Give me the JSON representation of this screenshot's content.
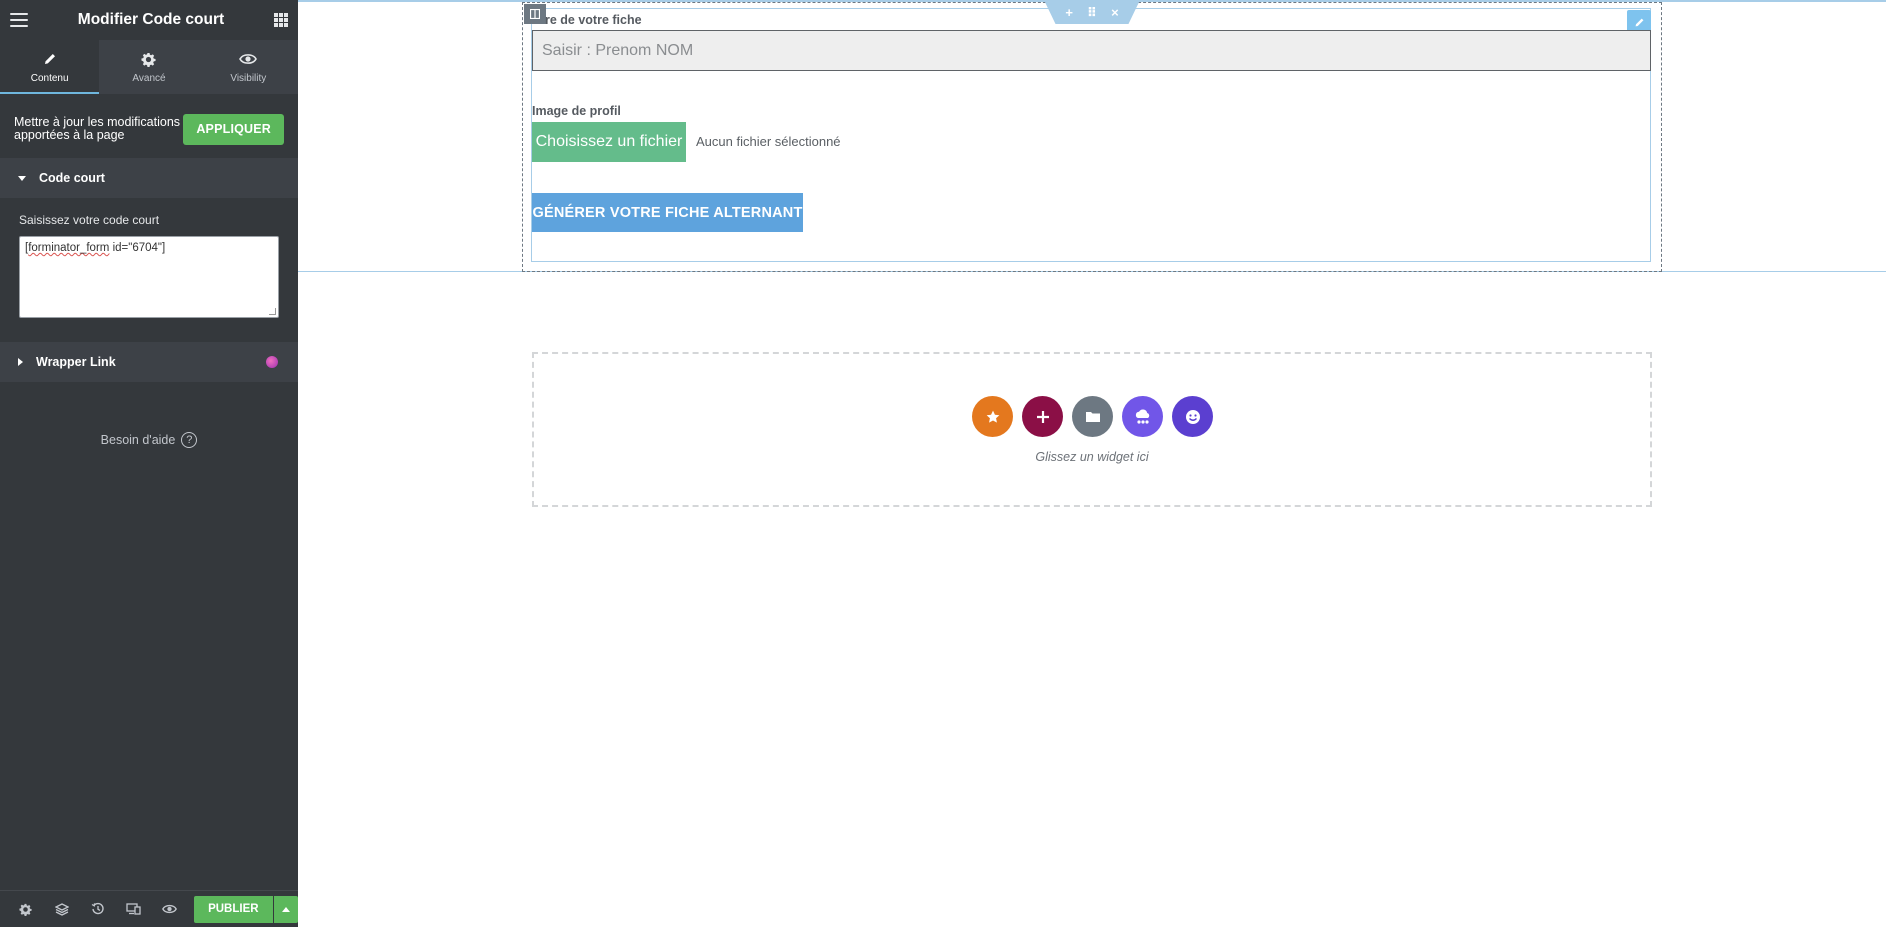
{
  "panel": {
    "title": "Modifier Code court",
    "tabs": [
      {
        "label": "Contenu",
        "icon": "pencil-icon"
      },
      {
        "label": "Avancé",
        "icon": "gear-icon"
      },
      {
        "label": "Visibility",
        "icon": "eye-icon"
      }
    ],
    "update_notice": "Mettre à jour les modifications apportées à la page",
    "apply_label": "APPLIQUER",
    "code_section": {
      "title": "Code court",
      "field_label": "Saisissez votre code court",
      "value_prefix": "[",
      "value_word": "forminator_form",
      "value_suffix": " id=\"6704\"]"
    },
    "wrapper_section": {
      "title": "Wrapper Link"
    },
    "help_label": "Besoin d'aide",
    "footer": {
      "publish_label": "PUBLIER"
    },
    "colors": {
      "panel_bg": "#34383c",
      "accent_green": "#5cb85c",
      "active_tab_line": "#6fb7de"
    }
  },
  "canvas": {
    "form": {
      "name_label": "re de votre fiche",
      "name_placeholder": "Saisir : Prenom NOM",
      "image_label": "Image de profil",
      "file_button": "Choisissez un fichier",
      "file_status": "Aucun fichier sélectionné",
      "submit_label": "GÉNÉRER VOTRE FICHE ALTERNANT"
    },
    "section_handle": {
      "add": "+",
      "move": "⠿",
      "close": "×"
    },
    "drop_zone": {
      "text": "Glissez un widget ici",
      "buttons": [
        {
          "name": "star-icon",
          "color": "#e4781e"
        },
        {
          "name": "plus-icon",
          "color": "#8b0f46"
        },
        {
          "name": "folder-icon",
          "color": "#6d7882"
        },
        {
          "name": "cloud-icon",
          "color": "#7156e8"
        },
        {
          "name": "smiley-icon",
          "color": "#5b3fd0"
        }
      ]
    },
    "colors": {
      "selection": "#a7cde8",
      "file_button": "#64bc8b",
      "submit_button": "#5ea3dd"
    }
  }
}
